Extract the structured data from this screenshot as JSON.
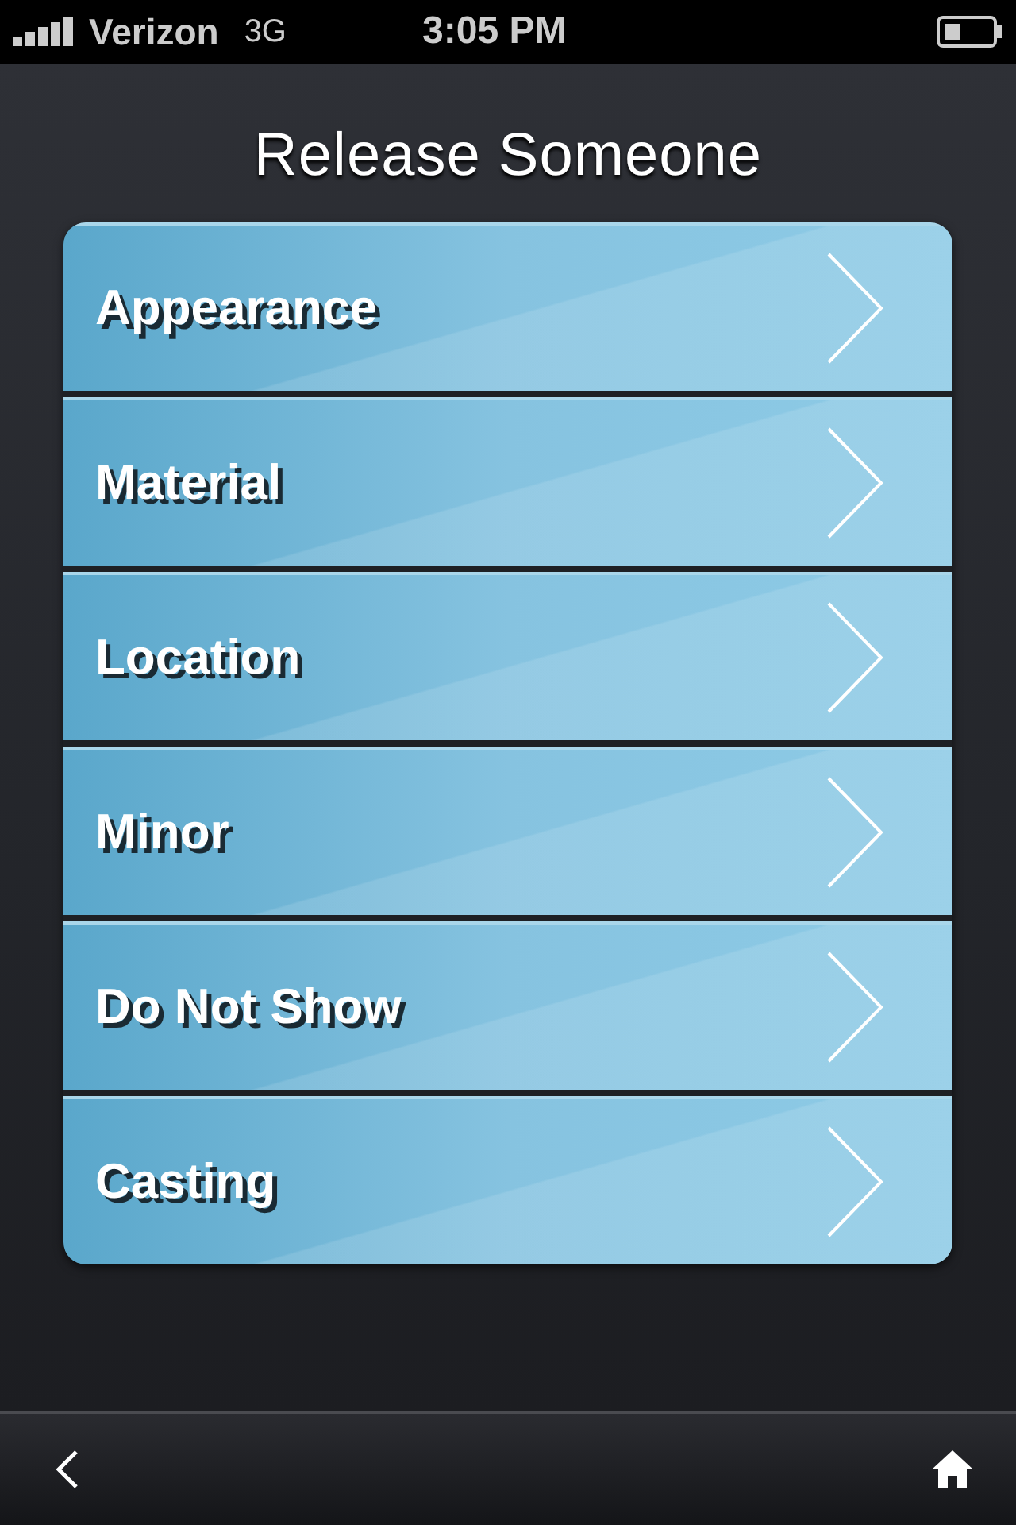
{
  "status_bar": {
    "carrier": "Verizon",
    "network": "3G",
    "time": "3:05 PM"
  },
  "title": "Release Someone",
  "menu_items": [
    {
      "label": "Appearance"
    },
    {
      "label": "Material"
    },
    {
      "label": "Location"
    },
    {
      "label": "Minor"
    },
    {
      "label": "Do Not Show"
    },
    {
      "label": "Casting"
    }
  ]
}
